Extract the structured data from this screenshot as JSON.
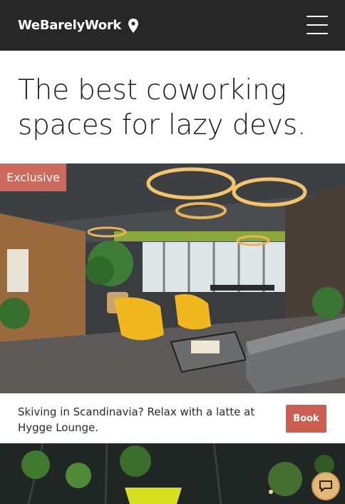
{
  "header": {
    "brand": "WeBarelyWork",
    "brand_icon": "map-pin-icon",
    "menu_icon": "hamburger-menu-icon"
  },
  "hero": {
    "title": "The best coworking spaces for lazy devs."
  },
  "cards": [
    {
      "badge": "Exclusive",
      "description": "Skiving in Scandinavia? Relax with a latte at Hygge Lounge.",
      "cta": "Book"
    }
  ],
  "chat": {
    "icon": "chat-bubble-icon"
  },
  "colors": {
    "navbar": "#272727",
    "accent": "#cc6a5c",
    "chat_button": "#e4b978"
  }
}
